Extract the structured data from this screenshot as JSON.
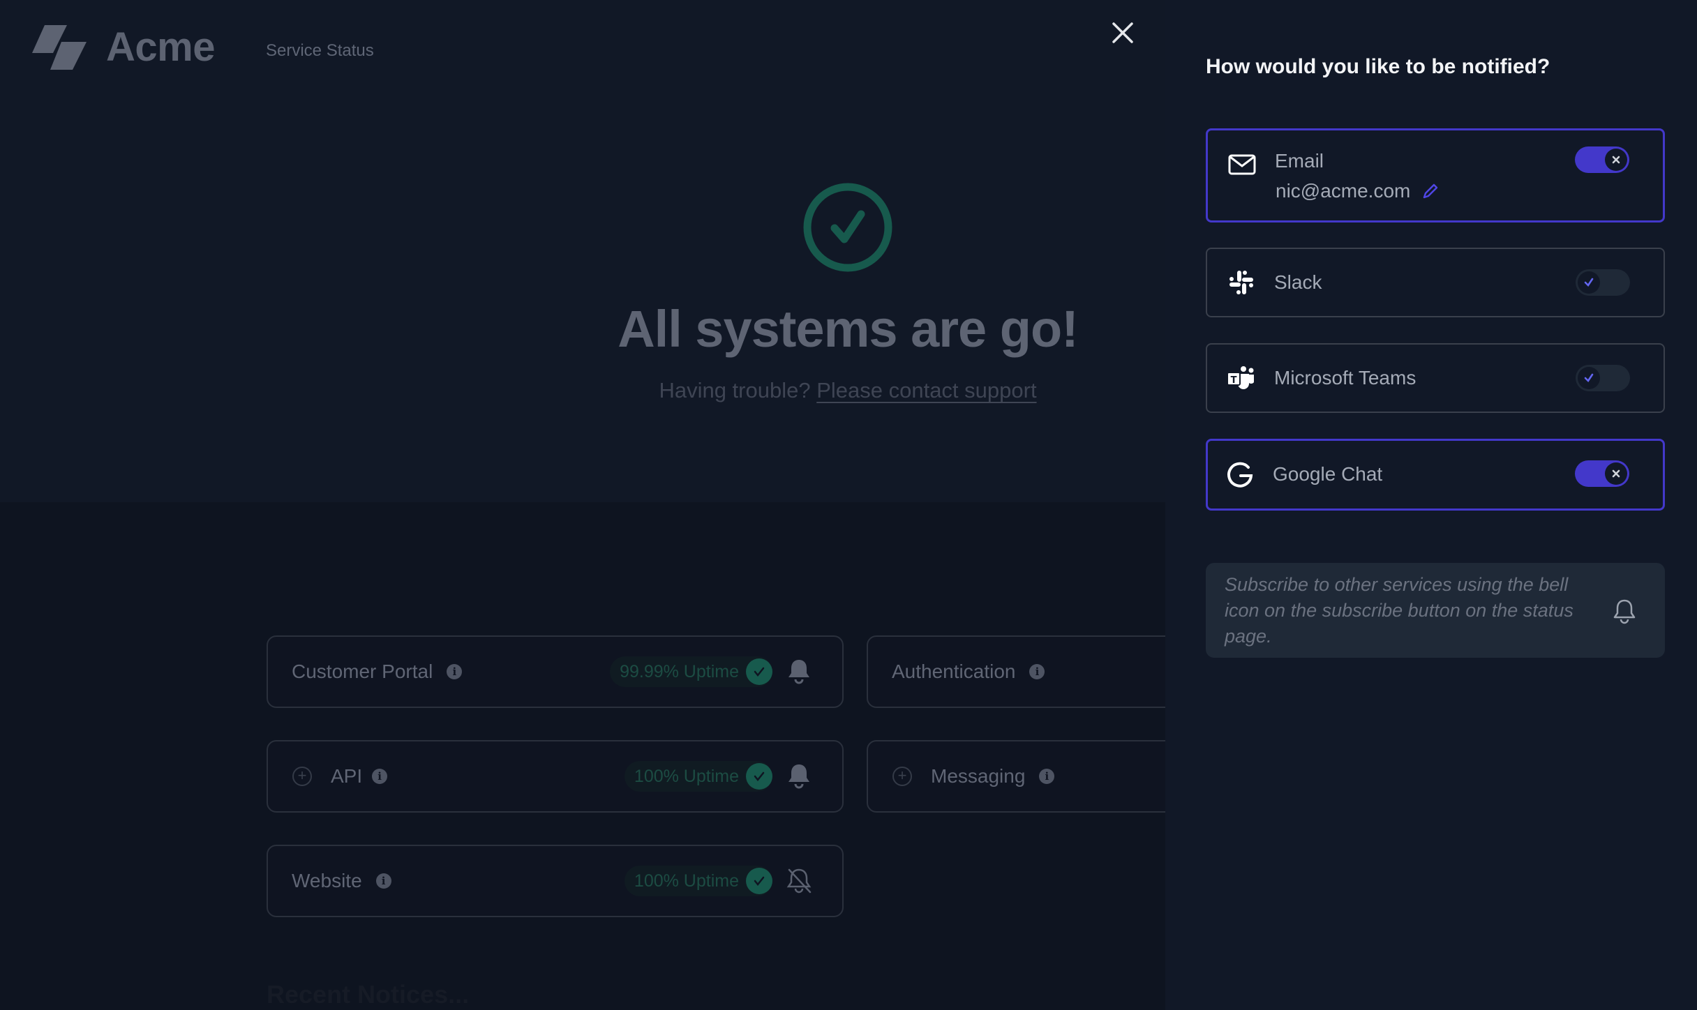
{
  "header": {
    "brand": "Acme",
    "nav_link": "Service Status",
    "logo_icon": "acme-logo-icon",
    "close_icon": "close-icon"
  },
  "hero": {
    "status_icon": "check-circle-icon",
    "title": "All systems are go!",
    "subtitle_prefix": "Having trouble?",
    "support_link": "Please contact support"
  },
  "services": [
    {
      "name": "Customer Portal",
      "uptime": "99.99% Uptime",
      "expandable": false,
      "subscribed": true,
      "bell_icon": "bell-icon"
    },
    {
      "name": "Authentication",
      "uptime": "",
      "expandable": false,
      "subscribed": null
    },
    {
      "name": "API",
      "uptime": "100% Uptime",
      "expandable": true,
      "subscribed": true,
      "bell_icon": "bell-icon"
    },
    {
      "name": "Messaging",
      "uptime": "",
      "expandable": true,
      "subscribed": null
    },
    {
      "name": "Website",
      "uptime": "100% Uptime",
      "expandable": false,
      "subscribed": false,
      "bell_icon": "bell-off-icon"
    }
  ],
  "recent_notices": "Recent Notices...",
  "panel": {
    "title": "How would you like to be notified?",
    "channels": [
      {
        "id": "email",
        "label": "Email",
        "value": "nic@acme.com",
        "enabled": true,
        "icon": "mail-icon",
        "edit_icon": "pencil-icon"
      },
      {
        "id": "slack",
        "label": "Slack",
        "enabled": false,
        "icon": "slack-icon"
      },
      {
        "id": "teams",
        "label": "Microsoft Teams",
        "enabled": false,
        "icon": "teams-icon"
      },
      {
        "id": "gchat",
        "label": "Google Chat",
        "enabled": true,
        "icon": "google-icon"
      }
    ],
    "tip": "Subscribe to other services using the bell icon on the subscribe button on the status page.",
    "tip_icon": "bell-icon"
  },
  "colors": {
    "accent": "#4338ca",
    "success": "#175a4d",
    "panel_bg": "#111827",
    "page_bg": "#0f1421"
  }
}
